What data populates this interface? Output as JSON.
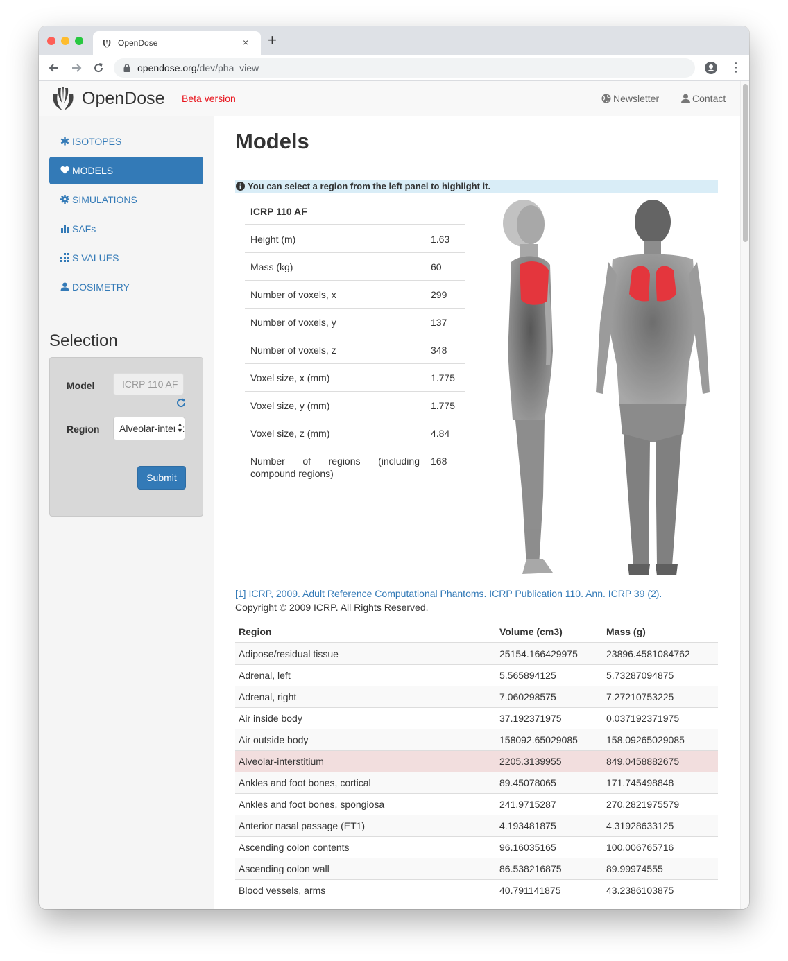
{
  "browser": {
    "tab_title": "OpenDose",
    "tab_close": "×",
    "new_tab": "+",
    "url_domain": "opendose.org",
    "url_path": "/dev/pha_view"
  },
  "navbar": {
    "brand": "OpenDose",
    "beta": "Beta version",
    "newsletter": "Newsletter",
    "contact": "Contact"
  },
  "sidebar": {
    "items": [
      {
        "label": "ISOTOPES",
        "icon": "asterisk-icon"
      },
      {
        "label": "MODELS",
        "icon": "heart-icon"
      },
      {
        "label": "SIMULATIONS",
        "icon": "cog-icon"
      },
      {
        "label": "SAFs",
        "icon": "bar-chart-icon"
      },
      {
        "label": "S VALUES",
        "icon": "grid-chart-icon"
      },
      {
        "label": "DOSIMETRY",
        "icon": "user-icon"
      }
    ],
    "active_index": 1
  },
  "selection": {
    "title": "Selection",
    "model_label": "Model",
    "model_value": "ICRP 110 AF",
    "region_label": "Region",
    "region_value": "Alveolar-interstitium",
    "submit_label": "Submit"
  },
  "main": {
    "title": "Models",
    "alert": "You can select a region from the left panel to highlight it.",
    "model_name": "ICRP 110 AF",
    "properties": [
      {
        "label": "Height (m)",
        "value": "1.63"
      },
      {
        "label": "Mass (kg)",
        "value": "60"
      },
      {
        "label": "Number of voxels, x",
        "value": "299"
      },
      {
        "label": "Number of voxels, y",
        "value": "137"
      },
      {
        "label": "Number of voxels, z",
        "value": "348"
      },
      {
        "label": "Voxel size, x (mm)",
        "value": "1.775"
      },
      {
        "label": "Voxel size, y (mm)",
        "value": "1.775"
      },
      {
        "label": "Voxel size, z (mm)",
        "value": "4.84"
      },
      {
        "label": "Number of regions (including compound regions)",
        "value": "168"
      }
    ],
    "reference": "[1] ICRP, 2009. Adult Reference Computational Phantoms. ICRP Publication 110. Ann. ICRP 39 (2).",
    "copyright": "Copyright © 2009 ICRP. All Rights Reserved.",
    "regions_table": {
      "headers": [
        "Region",
        "Volume (cm3)",
        "Mass (g)"
      ],
      "highlight_index": 5,
      "rows": [
        [
          "Adipose/residual tissue",
          "25154.166429975",
          "23896.4581084762"
        ],
        [
          "Adrenal, left",
          "5.565894125",
          "5.73287094875"
        ],
        [
          "Adrenal, right",
          "7.060298575",
          "7.27210753225"
        ],
        [
          "Air inside body",
          "37.192371975",
          "0.037192371975"
        ],
        [
          "Air outside body",
          "158092.65029085",
          "158.09265029085"
        ],
        [
          "Alveolar-interstitium",
          "2205.3139955",
          "849.0458882675"
        ],
        [
          "Ankles and foot bones, cortical",
          "89.45078065",
          "171.745498848"
        ],
        [
          "Ankles and foot bones, spongiosa",
          "241.9715287",
          "270.2821975579"
        ],
        [
          "Anterior nasal passage (ET1)",
          "4.193481875",
          "4.31928633125"
        ],
        [
          "Ascending colon contents",
          "96.16035165",
          "100.006765716"
        ],
        [
          "Ascending colon wall",
          "86.538216875",
          "89.99974555"
        ],
        [
          "Blood vessels, arms",
          "40.791141875",
          "43.2386103875"
        ]
      ]
    }
  },
  "colors": {
    "link": "#337ab7",
    "beta": "#e8141c",
    "highlight_row": "#f2dede",
    "alert_bg": "#d9edf7",
    "organ_highlight": "#e0141c"
  }
}
